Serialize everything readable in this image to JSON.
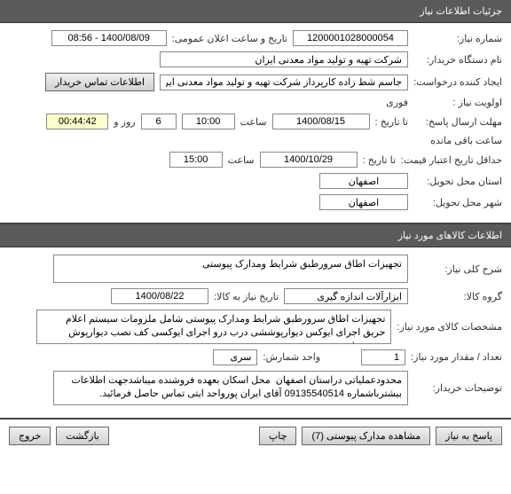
{
  "headers": {
    "need_details": "جزئیات اطلاعات نیاز",
    "goods_info": "اطلاعات کالاهای مورد نیاز"
  },
  "s1": {
    "need_number_label": "شماره نیاز:",
    "need_number": "1200001028000054",
    "announce_date_label": "تاریخ و ساعت اعلان عمومی:",
    "announce_date": "1400/08/09 - 08:56",
    "buyer_org_label": "نام دستگاه خریدار:",
    "buyer_org": "شرکت تهیه و تولید مواد معدنی ایران",
    "creator_label": "ایجاد کننده درخواست:",
    "creator": "جاسم شط زاده کارپرداز شرکت تهیه و تولید مواد معدنی ایران",
    "contact_btn": "اطلاعات تماس خریدار",
    "priority_label": "اولویت نیاز :",
    "priority": "فوری",
    "response_deadline_label": "مهلت ارسال پاسخ:",
    "to_date_label": "تا تاریخ :",
    "resp_date": "1400/08/15",
    "time_label": "ساعت",
    "resp_time": "10:00",
    "days_val": "6",
    "days_label": "روز و",
    "counter": "00:44:42",
    "remaining_label": "ساعت باقی مانده",
    "min_validity_label": "حداقل تاریخ اعتبار قیمت:",
    "min_date": "1400/10/29",
    "min_time": "15:00",
    "province_label": "استان محل تحویل:",
    "province": "اصفهان",
    "city_label": "شهر محل تحویل:",
    "city": "اصفهان"
  },
  "s2": {
    "desc_label": "شرح کلی نیاز:",
    "desc": "تجهیزات اطاق سرورطبق شرایط ومدارک پیوستی",
    "group_label": "گروه کالا:",
    "group": "ابزارآلات اندازه گیری",
    "need_date_label": "تاریخ نیاز به کالا:",
    "need_date": "1400/08/22",
    "spec_label": "مشخصات کالای مورد نیاز:",
    "spec": "تجهیزات اطاق سرورطبق شرایط ومدارک پیوستی شامل ملزومات سیستم اعلام حریق اجرای ایوکس دیوارپوششی درب درو اجرای ایوکسی کف نصب دیوارپوش وغیره طبق شرح پیوست",
    "qty_label": "تعداد / مقدار مورد نياز:",
    "qty": "1",
    "unit_label": "واحد شمارش:",
    "unit": "سری",
    "buyer_notes_label": "توضیحات خریدار:",
    "buyer_notes": "محدودعملیاتی دراستان اصفهان  محل اسکان بعهده فروشنده میباشدجهت اطلاعات بیشترباشماره 09135540514 آقای ایران پورواحد ایتی تماس حاصل فرمائید."
  },
  "buttons": {
    "respond": "پاسخ به نیاز",
    "attachments": "مشاهده مدارک پیوستی (7)",
    "print": "چاپ",
    "back": "بازگشت",
    "exit": "خروج"
  }
}
